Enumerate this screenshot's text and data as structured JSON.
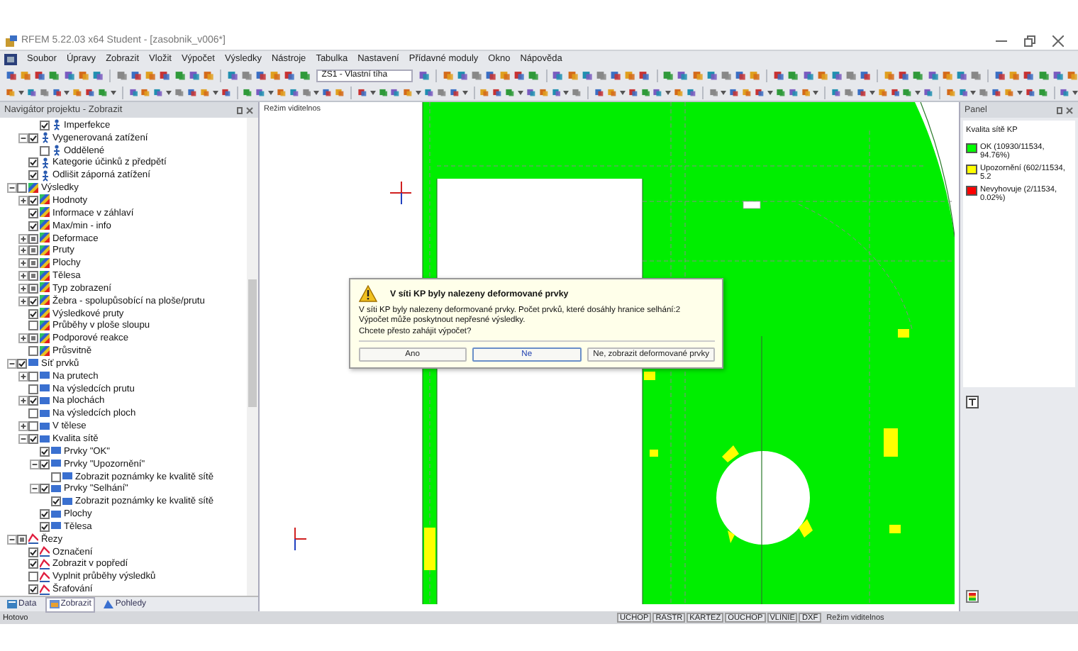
{
  "window": {
    "title": "RFEM 5.22.03 x64 Student - [zasobnik_v006*]"
  },
  "menu": [
    "Soubor",
    "Úpravy",
    "Zobrazit",
    "Vložit",
    "Výpočet",
    "Výsledky",
    "Nástroje",
    "Tabulka",
    "Nastavení",
    "Přídavné moduly",
    "Okno",
    "Nápověda"
  ],
  "toolbar": {
    "load_case": "ZS1 - Vlastní tíha"
  },
  "navigator": {
    "title": "Navigátor projektu - Zobrazit",
    "tree": [
      {
        "children": [
          {
            "children": [
              {
                "label": "Imperfekce",
                "kind": "load",
                "checked": true
              }
            ]
          },
          {
            "label": "Vygenerovaná zatížení",
            "kind": "load",
            "checked": true,
            "expanded": true,
            "children": [
              {
                "label": "Oddělené",
                "kind": "load",
                "checked": false
              }
            ]
          },
          {
            "label": "Kategorie účinků z předpětí",
            "kind": "load",
            "checked": true
          },
          {
            "label": "Odlišit záporná zatížení",
            "kind": "load",
            "checked": true
          }
        ]
      },
      {
        "label": "Výsledky",
        "kind": "results",
        "checked": false,
        "expanded": true,
        "children": [
          {
            "label": "Hodnoty",
            "kind": "results",
            "checked": true,
            "expanded": false
          },
          {
            "label": "Informace v záhlaví",
            "kind": "results",
            "checked": true
          },
          {
            "label": "Max/min - info",
            "kind": "results",
            "checked": true
          },
          {
            "label": "Deformace",
            "kind": "results",
            "checked": false,
            "indeterminate": true,
            "expanded": false
          },
          {
            "label": "Pruty",
            "kind": "results",
            "checked": false,
            "indeterminate": true,
            "expanded": false
          },
          {
            "label": "Plochy",
            "kind": "results",
            "checked": false,
            "indeterminate": true,
            "expanded": false
          },
          {
            "label": "Tělesa",
            "kind": "results",
            "checked": false,
            "indeterminate": true,
            "expanded": false
          },
          {
            "label": "Typ zobrazení",
            "kind": "results",
            "checked": false,
            "indeterminate": true,
            "expanded": false
          },
          {
            "label": "Žebra - spolupůsobící na ploše/prutu",
            "kind": "results",
            "checked": true,
            "expanded": false
          },
          {
            "label": "Výsledkové pruty",
            "kind": "results",
            "checked": true
          },
          {
            "label": "Průběhy v ploše sloupu",
            "kind": "results",
            "checked": false
          },
          {
            "label": "Podporové reakce",
            "kind": "results",
            "checked": false,
            "indeterminate": true,
            "expanded": false
          },
          {
            "label": "Průsvitně",
            "kind": "results",
            "checked": false
          }
        ]
      },
      {
        "label": "Síť prvků",
        "kind": "mesh",
        "checked": true,
        "expanded": true,
        "children": [
          {
            "label": "Na prutech",
            "kind": "mesh",
            "checked": false,
            "expanded": false
          },
          {
            "label": "Na výsledcích prutu",
            "kind": "mesh",
            "checked": false
          },
          {
            "label": "Na plochách",
            "kind": "mesh",
            "checked": true,
            "expanded": false
          },
          {
            "label": "Na výsledcích ploch",
            "kind": "mesh",
            "checked": false
          },
          {
            "label": "V tělese",
            "kind": "mesh",
            "checked": false,
            "expanded": false
          },
          {
            "label": "Kvalita sítě",
            "kind": "mesh",
            "checked": true,
            "expanded": true,
            "children": [
              {
                "label": "Prvky \"OK\"",
                "kind": "mesh",
                "checked": true
              },
              {
                "label": "Prvky \"Upozornění\"",
                "kind": "mesh",
                "checked": true,
                "expanded": true,
                "children": [
                  {
                    "label": "Zobrazit poznámky ke kvalitě sítě",
                    "kind": "mesh",
                    "checked": false
                  }
                ]
              },
              {
                "label": "Prvky \"Selhání\"",
                "kind": "mesh",
                "checked": true,
                "expanded": true,
                "children": [
                  {
                    "label": "Zobrazit poznámky ke kvalitě sítě",
                    "kind": "mesh",
                    "checked": true
                  }
                ]
              },
              {
                "label": "Plochy",
                "kind": "mesh",
                "checked": true
              },
              {
                "label": "Tělesa",
                "kind": "mesh",
                "checked": true
              }
            ]
          }
        ]
      },
      {
        "label": "Řezy",
        "kind": "section",
        "checked": false,
        "indeterminate": true,
        "expanded": true,
        "children": [
          {
            "label": "Označení",
            "kind": "section",
            "checked": true
          },
          {
            "label": "Zobrazit v popředí",
            "kind": "section",
            "checked": true
          },
          {
            "label": "Vyplnit průběhy výsledků",
            "kind": "section",
            "checked": false
          },
          {
            "label": "Šrafování",
            "kind": "section",
            "checked": true
          }
        ]
      }
    ],
    "tabs": [
      {
        "label": "Data",
        "selected": false
      },
      {
        "label": "Zobrazit",
        "selected": true
      },
      {
        "label": "Pohledy",
        "selected": false
      }
    ]
  },
  "view": {
    "label": "Režim viditelnos"
  },
  "dialog": {
    "title": "V síti KP byly nalezeny deformované prvky",
    "message_lines": [
      "V síti KP byly nalezeny deformované prvky. Počet prvků, které dosáhly hranice selhání:2",
      "Výpočet může poskytnout nepřesné výsledky.",
      "Chcete přesto zahájit výpočet?"
    ],
    "buttons": [
      {
        "label": "Ano",
        "selected": false
      },
      {
        "label": "Ne",
        "selected": true
      },
      {
        "label": "Ne, zobrazit deformované prvky",
        "selected": false
      }
    ]
  },
  "panel": {
    "title": "Panel",
    "heading": "Kvalita sítě KP",
    "legend": [
      {
        "label": "OK (10930/11534, 94.76%)",
        "color": "#00ff00"
      },
      {
        "label": "Upozornění (602/11534, 5.2",
        "color": "#ffff00"
      },
      {
        "label": "Nevyhovuje (2/11534, 0.02%)",
        "color": "#ff0000"
      }
    ]
  },
  "status_bar": {
    "text": "Hotovo",
    "toggles": [
      "UCHOP",
      "RASTR",
      "KARTEZ",
      "OUCHOP",
      "VLINIE",
      "DXF"
    ],
    "mode": "Režim viditelnos"
  }
}
